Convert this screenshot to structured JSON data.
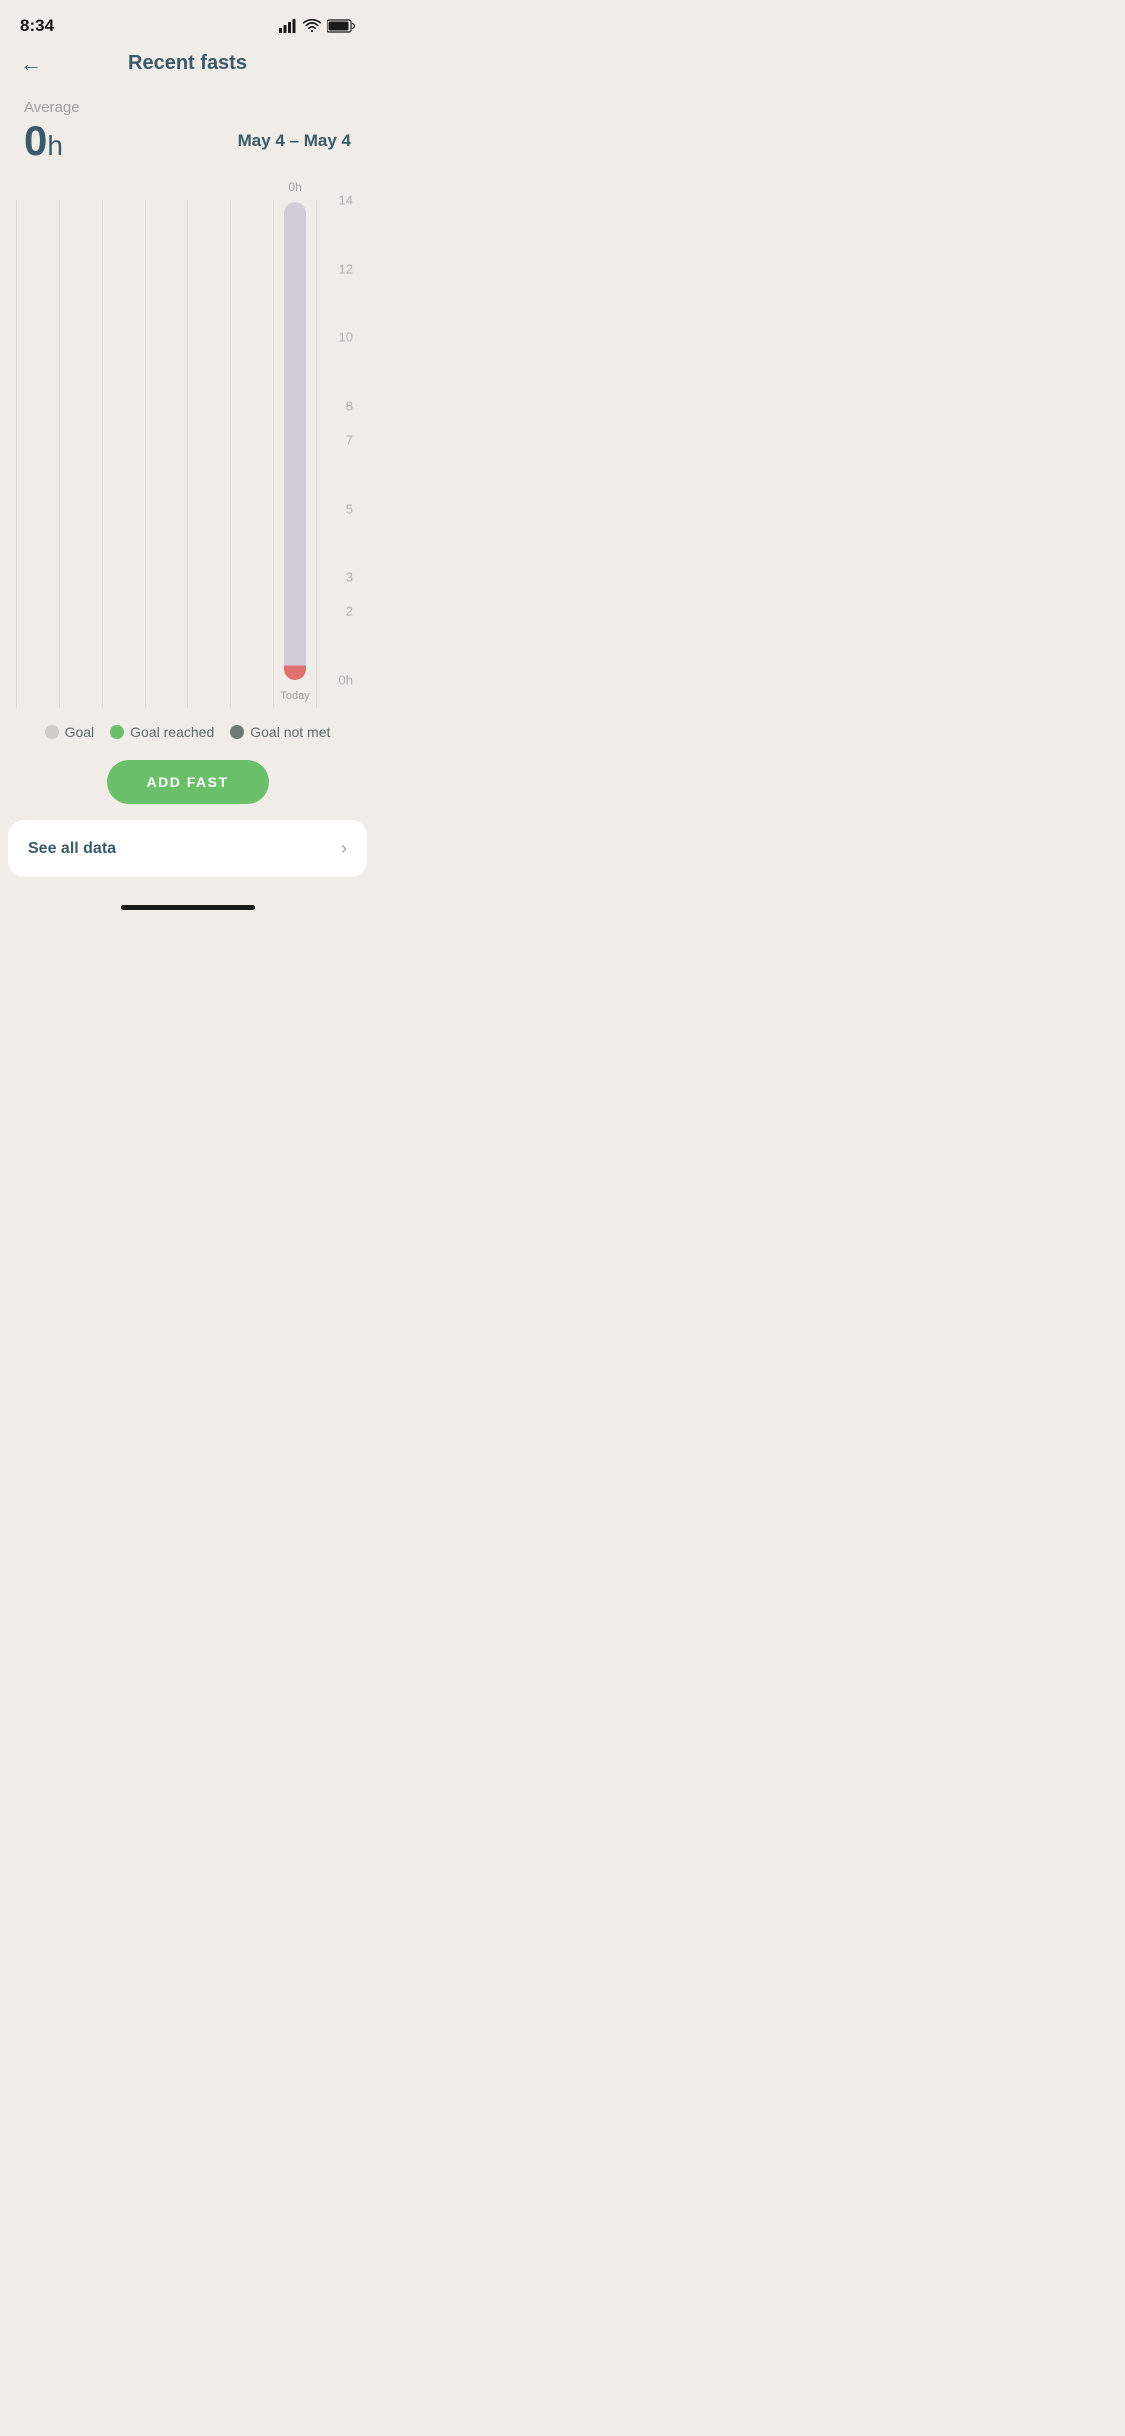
{
  "statusBar": {
    "time": "8:34",
    "icons": {
      "signal": "signal-icon",
      "wifi": "wifi-icon",
      "battery": "battery-icon"
    }
  },
  "nav": {
    "backLabel": "←",
    "title": "Recent fasts"
  },
  "stats": {
    "averageLabel": "Average",
    "averageValue": "0",
    "averageUnit": "h",
    "dateRange": "May 4 – May 4"
  },
  "chart": {
    "topBarLabel": "0h",
    "todayLabel": "Today",
    "yAxisLabels": [
      "14",
      "12",
      "10",
      "8",
      "7",
      "5",
      "3",
      "2",
      "0h"
    ],
    "bars": [
      {
        "id": "col1",
        "hasBar": false,
        "label": ""
      },
      {
        "id": "col2",
        "hasBar": false,
        "label": ""
      },
      {
        "id": "col3",
        "hasBar": false,
        "label": ""
      },
      {
        "id": "col4",
        "hasBar": false,
        "label": ""
      },
      {
        "id": "col5",
        "hasBar": false,
        "label": ""
      },
      {
        "id": "col6",
        "hasBar": false,
        "label": ""
      },
      {
        "id": "col7",
        "hasBar": true,
        "label": "Today",
        "isToday": true,
        "topLabel": "0h"
      }
    ]
  },
  "legend": {
    "items": [
      {
        "type": "goal",
        "label": "Goal"
      },
      {
        "type": "reached",
        "label": "Goal reached"
      },
      {
        "type": "not-met",
        "label": "Goal not met"
      }
    ]
  },
  "addFastButton": {
    "label": "ADD FAST"
  },
  "seeAllData": {
    "label": "See all data",
    "arrow": "›"
  }
}
